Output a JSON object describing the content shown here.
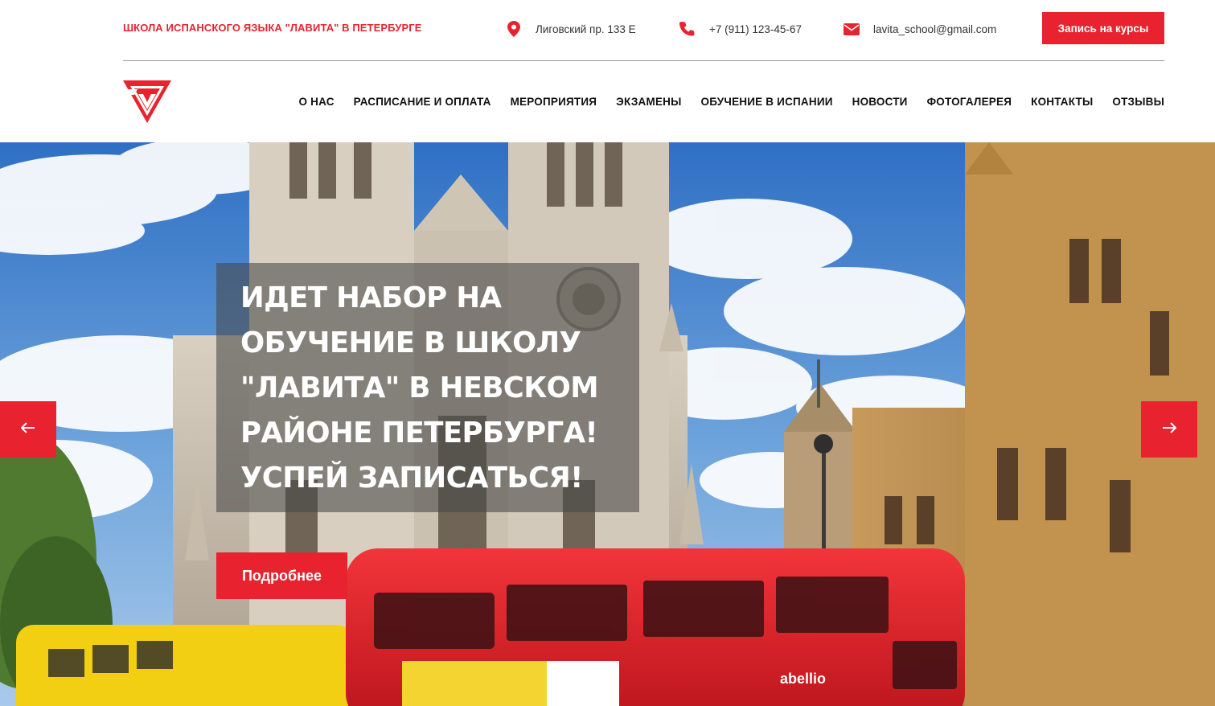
{
  "header": {
    "school_name": "ШКОЛА ИСПАНСКОГО ЯЗЫКА \"ЛАВИТА\" В ПЕТЕРБУРГЕ",
    "address": "Лиговский пр. 133 Е",
    "phone": "+7 (911) 123-45-67",
    "email": "lavita_school@gmail.com",
    "signup_label": "Запись на курсы",
    "icons": [
      "map-pin-icon",
      "phone-icon",
      "envelope-icon"
    ],
    "accent_color": "#e8232f"
  },
  "nav": {
    "logo_icon": "lavita-logo",
    "items": [
      "О НАС",
      "РАСПИСАНИЕ И ОПЛАТА",
      "МЕРОПРИЯТИЯ",
      "ЭКЗАМЕНЫ",
      "ОБУЧЕНИЕ В ИСПАНИИ",
      "НОВОСТИ",
      "ФОТОГАЛЕРЕЯ",
      "КОНТАКТЫ",
      "ОТЗЫВЫ"
    ]
  },
  "hero": {
    "title": "ИДЕТ НАБОР НА ОБУЧЕНИЕ В ШКОЛУ \"ЛАВИТА\" В НЕВСКОМ РАЙОНЕ ПЕТЕРБУРГА! УСПЕЙ ЗАПИСАТЬСЯ!",
    "button_label": "Подробнее",
    "prev_icon": "arrow-left-icon",
    "next_icon": "arrow-right-icon"
  }
}
